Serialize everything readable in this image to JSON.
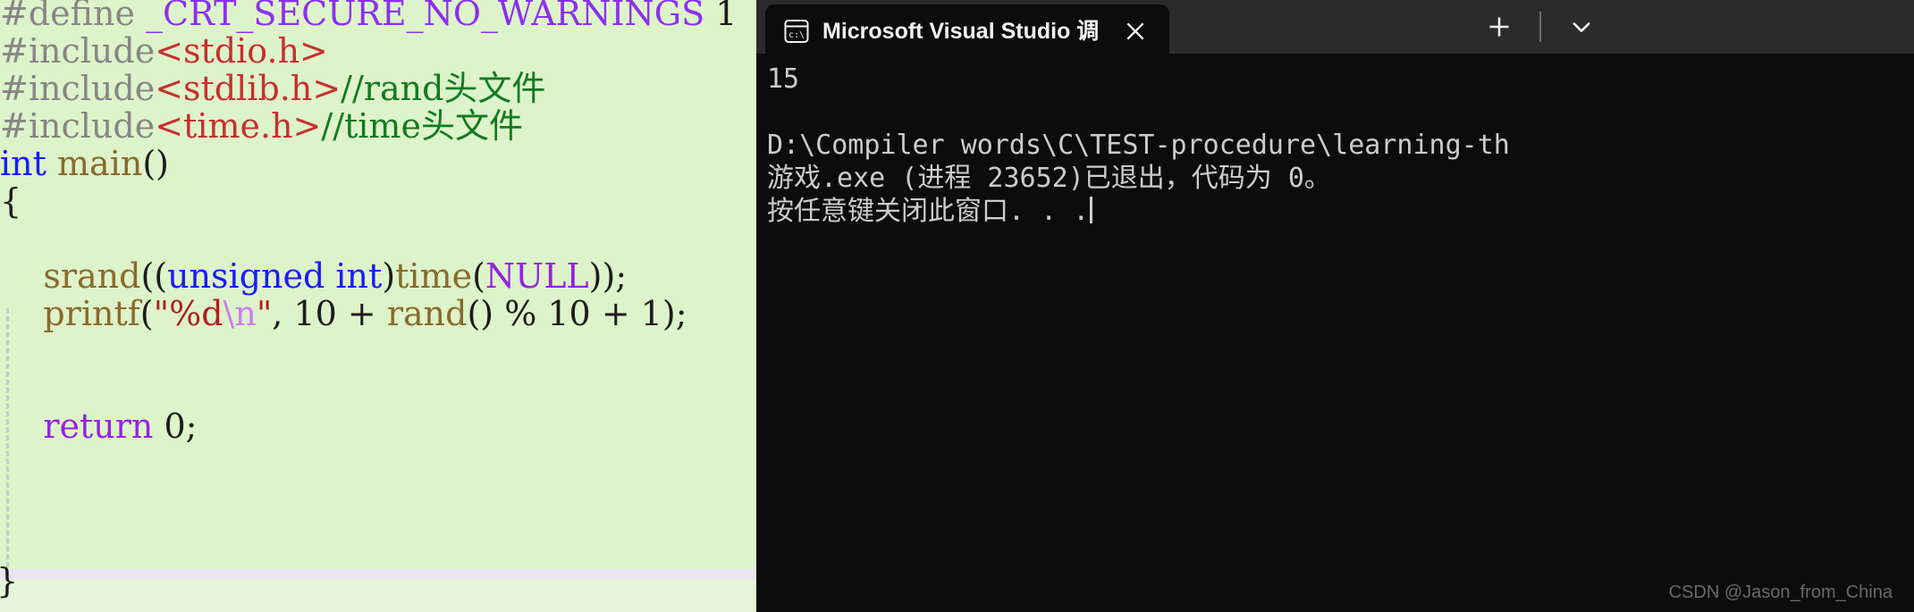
{
  "editor": {
    "background_color": "#ddf3ca",
    "footer_background_color": "#e4f5d8",
    "separator_color": "#e9e6f2",
    "lines": [
      {
        "id": "line-define",
        "tokens": [
          {
            "text": "#define ",
            "cls": "tok-pre"
          },
          {
            "text": "_CRT_SECURE_NO_WARNINGS",
            "cls": "tok-macro"
          },
          {
            "text": " 1",
            "cls": "tok-num"
          }
        ]
      },
      {
        "id": "line-include-stdio",
        "tokens": [
          {
            "text": "#include",
            "cls": "tok-pre"
          },
          {
            "text": "<stdio.h>",
            "cls": "tok-hdr"
          }
        ]
      },
      {
        "id": "line-include-stdlib",
        "tokens": [
          {
            "text": "#include",
            "cls": "tok-pre"
          },
          {
            "text": "<stdlib.h>",
            "cls": "tok-hdr"
          },
          {
            "text": "//rand头文件",
            "cls": "tok-cmt"
          }
        ]
      },
      {
        "id": "line-include-time",
        "tokens": [
          {
            "text": "#include",
            "cls": "tok-pre"
          },
          {
            "text": "<time.h>",
            "cls": "tok-hdr"
          },
          {
            "text": "//time头文件",
            "cls": "tok-cmt"
          }
        ]
      },
      {
        "id": "line-main",
        "tokens": [
          {
            "text": "int",
            "cls": "tok-kw"
          },
          {
            "text": " ",
            "cls": "tok-plain"
          },
          {
            "text": "main",
            "cls": "tok-fn"
          },
          {
            "text": "()",
            "cls": "tok-punct"
          }
        ]
      },
      {
        "id": "line-open-brace",
        "tokens": [
          {
            "text": "{",
            "cls": "tok-brace"
          }
        ]
      },
      {
        "id": "line-blank-1",
        "tokens": [
          {
            "text": " ",
            "cls": "tok-plain"
          }
        ]
      },
      {
        "id": "line-srand",
        "tokens": [
          {
            "text": "    ",
            "cls": "tok-plain"
          },
          {
            "text": "srand",
            "cls": "tok-fn"
          },
          {
            "text": "((",
            "cls": "tok-punct"
          },
          {
            "text": "unsigned int",
            "cls": "tok-kw"
          },
          {
            "text": ")",
            "cls": "tok-punct"
          },
          {
            "text": "time",
            "cls": "tok-fn"
          },
          {
            "text": "(",
            "cls": "tok-punct"
          },
          {
            "text": "NULL",
            "cls": "tok-const"
          },
          {
            "text": "));",
            "cls": "tok-punct"
          }
        ]
      },
      {
        "id": "line-printf",
        "tokens": [
          {
            "text": "    ",
            "cls": "tok-plain"
          },
          {
            "text": "printf",
            "cls": "tok-fn"
          },
          {
            "text": "(",
            "cls": "tok-punct"
          },
          {
            "text": "\"%d",
            "cls": "tok-str"
          },
          {
            "text": "\\n",
            "cls": "tok-esc"
          },
          {
            "text": "\"",
            "cls": "tok-str"
          },
          {
            "text": ", ",
            "cls": "tok-punct"
          },
          {
            "text": "10",
            "cls": "tok-num"
          },
          {
            "text": " + ",
            "cls": "tok-punct"
          },
          {
            "text": "rand",
            "cls": "tok-fn"
          },
          {
            "text": "()",
            "cls": "tok-punct"
          },
          {
            "text": " % ",
            "cls": "tok-punct"
          },
          {
            "text": "10",
            "cls": "tok-num"
          },
          {
            "text": " + ",
            "cls": "tok-punct"
          },
          {
            "text": "1",
            "cls": "tok-num"
          },
          {
            "text": ");",
            "cls": "tok-punct"
          }
        ]
      },
      {
        "id": "line-blank-2",
        "tokens": [
          {
            "text": " ",
            "cls": "tok-plain"
          }
        ]
      },
      {
        "id": "line-blank-3",
        "tokens": [
          {
            "text": " ",
            "cls": "tok-plain"
          }
        ]
      },
      {
        "id": "line-return",
        "tokens": [
          {
            "text": "    ",
            "cls": "tok-plain"
          },
          {
            "text": "return",
            "cls": "tok-kw2"
          },
          {
            "text": " ",
            "cls": "tok-plain"
          },
          {
            "text": "0",
            "cls": "tok-num"
          },
          {
            "text": ";",
            "cls": "tok-punct"
          }
        ]
      }
    ],
    "footer_brace": "}"
  },
  "terminal": {
    "title": "Microsoft Visual Studio 调试控",
    "tab_icon_name": "console-icon",
    "close_label": "✕",
    "new_tab_label": "+",
    "dropdown_label": "⌄",
    "background_color": "#0c0c0c",
    "titlebar_color": "#2b2b2b",
    "text_color": "#cccccc",
    "output_lines": [
      {
        "id": "term-out-value",
        "text": "15"
      },
      {
        "id": "term-blank-1",
        "text": ""
      },
      {
        "id": "term-path",
        "text": "D:\\Compiler words\\C\\TEST-procedure\\learning-th"
      },
      {
        "id": "term-exit",
        "text": "游戏.exe (进程 23652)已退出，代码为 0。"
      }
    ],
    "prompt_line": "按任意键关闭此窗口. . .",
    "watermark": "CSDN @Jason_from_China"
  }
}
